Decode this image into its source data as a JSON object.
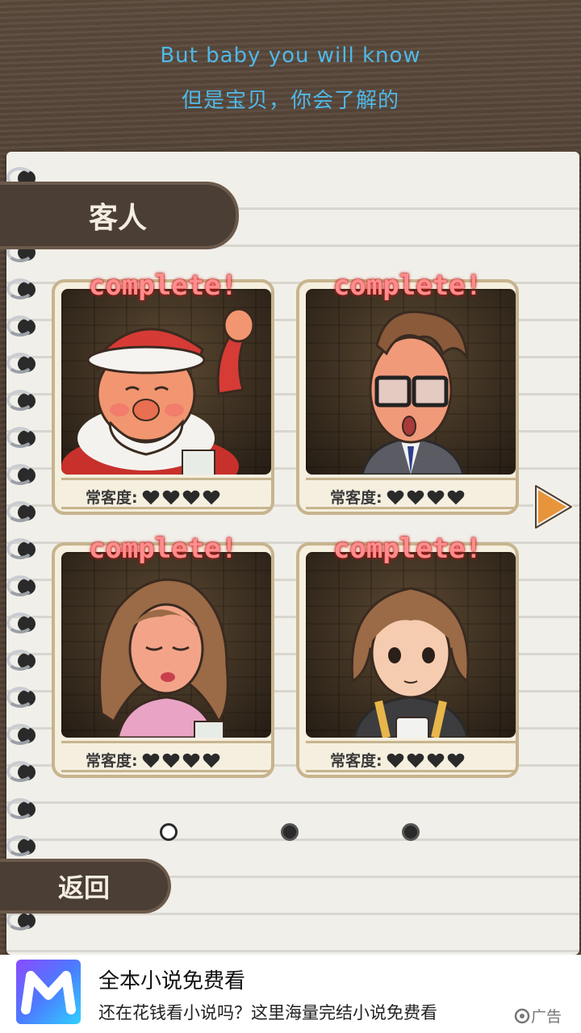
{
  "subtitle": {
    "en": "But baby you will know",
    "zh": "但是宝贝，你会了解的"
  },
  "header": {
    "title": "客人"
  },
  "customers": [
    {
      "status": "complete!",
      "affinity_label": "常客度:",
      "hearts": 4,
      "name": "santa"
    },
    {
      "status": "complete!",
      "affinity_label": "常客度:",
      "hearts": 4,
      "name": "glasses-man"
    },
    {
      "status": "complete!",
      "affinity_label": "常客度:",
      "hearts": 4,
      "name": "curly-hair-woman"
    },
    {
      "status": "complete!",
      "affinity_label": "常客度:",
      "hearts": 4,
      "name": "bob-hair-girl"
    }
  ],
  "pagination": {
    "pages": 3,
    "current": 1
  },
  "footer": {
    "back_label": "返回"
  },
  "ad": {
    "title": "全本小说免费看",
    "description": "还在花钱看小说吗？这里海量完结小说免费看",
    "badge": "广告"
  },
  "colors": {
    "subtitle": "#4fb8e8",
    "tab_bg": "#4a3e35",
    "complete_text": "#ff8d8d",
    "next_arrow": "#e8943a"
  }
}
